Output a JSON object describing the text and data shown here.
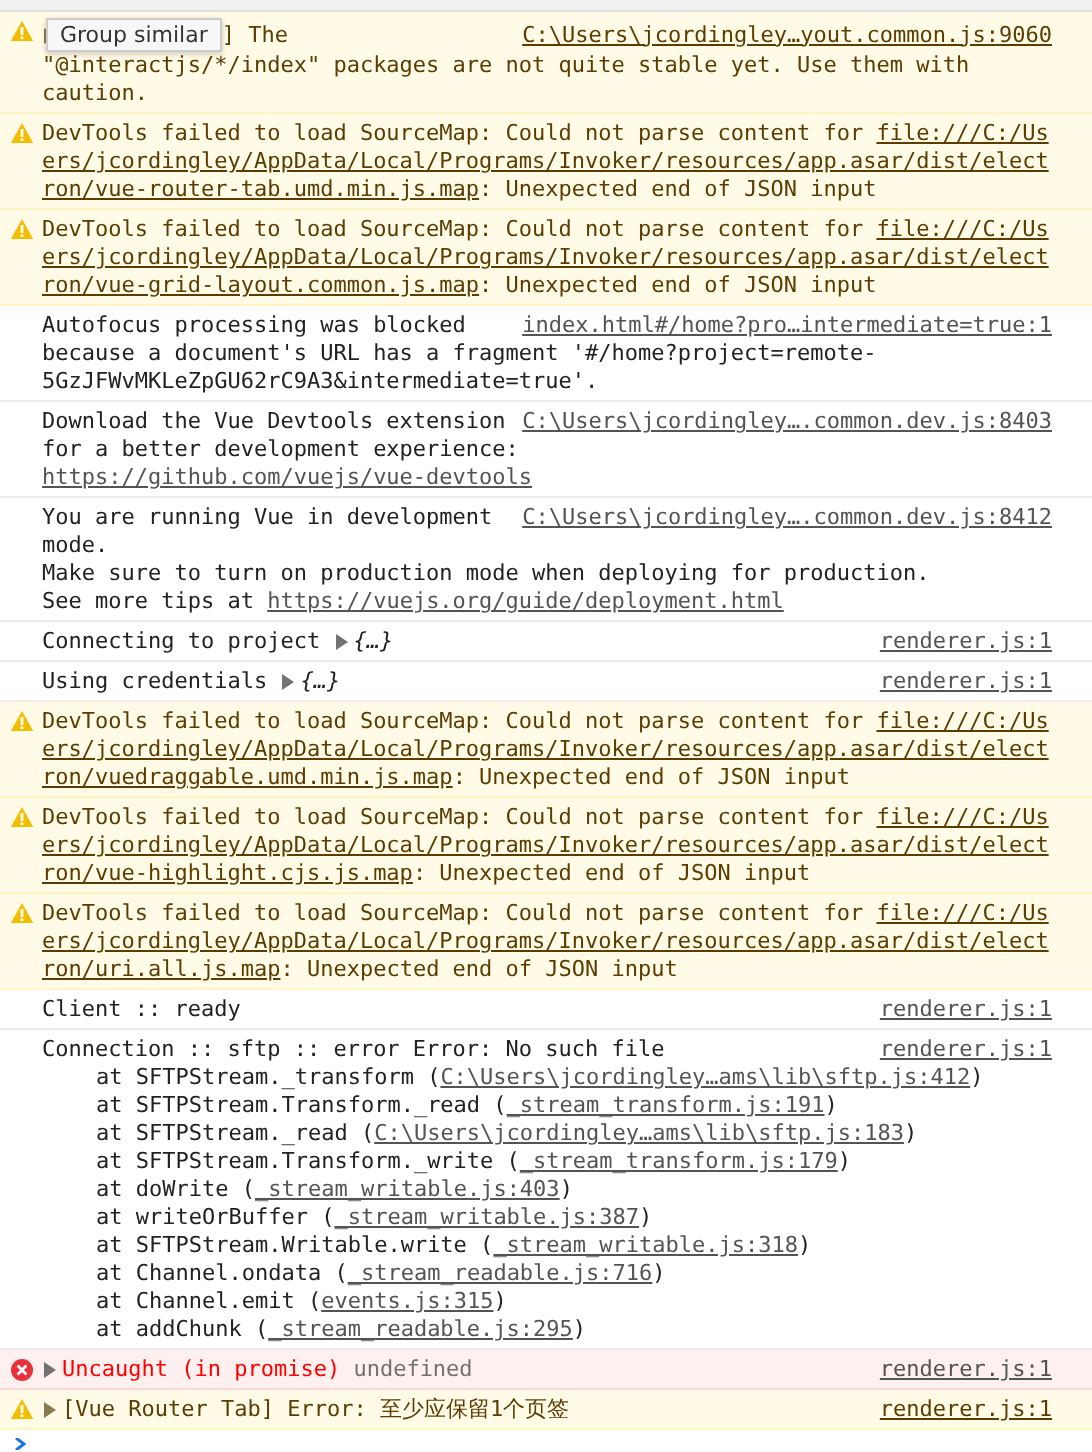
{
  "messages": [
    {
      "kind": "warning",
      "source": "C:\\Users\\jcordingley…yout.common.js:9060",
      "lines": [
        {
          "segments": [
            {
              "kind": "toggle"
            },
            {
              "kind": "tooltip",
              "text": "Group similar"
            },
            {
              "kind": "text",
              "text": "] The"
            }
          ]
        },
        {
          "segments": [
            {
              "kind": "text",
              "text": "\"@interactjs/*/index\" packages are not quite stable yet. Use them with"
            }
          ]
        },
        {
          "segments": [
            {
              "kind": "text",
              "text": "caution."
            }
          ]
        }
      ]
    },
    {
      "kind": "warning",
      "lines": [
        {
          "segments": [
            {
              "kind": "text",
              "text": "DevTools failed to load SourceMap: Could not parse content for "
            },
            {
              "kind": "link",
              "text": "file:///C:/Us"
            }
          ]
        },
        {
          "segments": [
            {
              "kind": "link",
              "text": "ers/jcordingley/AppData/Local/Programs/Invoker/resources/app.asar/dist/elect"
            }
          ]
        },
        {
          "segments": [
            {
              "kind": "link",
              "text": "ron/vue-router-tab.umd.min.js.map"
            },
            {
              "kind": "text",
              "text": ": Unexpected end of JSON input"
            }
          ]
        }
      ]
    },
    {
      "kind": "warning",
      "lines": [
        {
          "segments": [
            {
              "kind": "text",
              "text": "DevTools failed to load SourceMap: Could not parse content for "
            },
            {
              "kind": "link",
              "text": "file:///C:/Us"
            }
          ]
        },
        {
          "segments": [
            {
              "kind": "link",
              "text": "ers/jcordingley/AppData/Local/Programs/Invoker/resources/app.asar/dist/elect"
            }
          ]
        },
        {
          "segments": [
            {
              "kind": "link",
              "text": "ron/vue-grid-layout.common.js.map"
            },
            {
              "kind": "text",
              "text": ": Unexpected end of JSON input"
            }
          ]
        }
      ]
    },
    {
      "kind": "info",
      "source": "index.html#/home?pro…intermediate=true:1",
      "lines": [
        {
          "segments": [
            {
              "kind": "text",
              "text": "Autofocus processing was blocked"
            }
          ]
        },
        {
          "segments": [
            {
              "kind": "text",
              "text": "because a document's URL has a fragment '#/home?project=remote-"
            }
          ]
        },
        {
          "segments": [
            {
              "kind": "text",
              "text": "5GzJFWvMKLeZpGU62rC9A3&intermediate=true'."
            }
          ]
        }
      ]
    },
    {
      "kind": "info",
      "source": "C:\\Users\\jcordingley….common.dev.js:8403",
      "lines": [
        {
          "segments": [
            {
              "kind": "text",
              "text": "Download the Vue Devtools extension"
            }
          ]
        },
        {
          "segments": [
            {
              "kind": "text",
              "text": "for a better development experience:"
            }
          ]
        },
        {
          "segments": [
            {
              "kind": "link",
              "text": "https://github.com/vuejs/vue-devtools"
            }
          ]
        }
      ]
    },
    {
      "kind": "info",
      "source": "C:\\Users\\jcordingley….common.dev.js:8412",
      "lines": [
        {
          "segments": [
            {
              "kind": "text",
              "text": "You are running Vue in development"
            }
          ]
        },
        {
          "segments": [
            {
              "kind": "text",
              "text": "mode."
            }
          ]
        },
        {
          "segments": [
            {
              "kind": "text",
              "text": "Make sure to turn on production mode when deploying for production."
            }
          ]
        },
        {
          "segments": [
            {
              "kind": "text",
              "text": "See more tips at "
            },
            {
              "kind": "link",
              "text": "https://vuejs.org/guide/deployment.html"
            }
          ]
        }
      ]
    },
    {
      "kind": "info",
      "source": "renderer.js:1",
      "lines": [
        {
          "segments": [
            {
              "kind": "text",
              "text": "Connecting to project "
            },
            {
              "kind": "toggle"
            },
            {
              "kind": "object",
              "text": "{…}"
            }
          ]
        }
      ]
    },
    {
      "kind": "info",
      "source": "renderer.js:1",
      "lines": [
        {
          "segments": [
            {
              "kind": "text",
              "text": "Using credentials "
            },
            {
              "kind": "toggle"
            },
            {
              "kind": "object",
              "text": "{…}"
            }
          ]
        }
      ]
    },
    {
      "kind": "warning",
      "lines": [
        {
          "segments": [
            {
              "kind": "text",
              "text": "DevTools failed to load SourceMap: Could not parse content for "
            },
            {
              "kind": "link",
              "text": "file:///C:/Us"
            }
          ]
        },
        {
          "segments": [
            {
              "kind": "link",
              "text": "ers/jcordingley/AppData/Local/Programs/Invoker/resources/app.asar/dist/elect"
            }
          ]
        },
        {
          "segments": [
            {
              "kind": "link",
              "text": "ron/vuedraggable.umd.min.js.map"
            },
            {
              "kind": "text",
              "text": ": Unexpected end of JSON input"
            }
          ]
        }
      ]
    },
    {
      "kind": "warning",
      "lines": [
        {
          "segments": [
            {
              "kind": "text",
              "text": "DevTools failed to load SourceMap: Could not parse content for "
            },
            {
              "kind": "link",
              "text": "file:///C:/Us"
            }
          ]
        },
        {
          "segments": [
            {
              "kind": "link",
              "text": "ers/jcordingley/AppData/Local/Programs/Invoker/resources/app.asar/dist/elect"
            }
          ]
        },
        {
          "segments": [
            {
              "kind": "link",
              "text": "ron/vue-highlight.cjs.js.map"
            },
            {
              "kind": "text",
              "text": ": Unexpected end of JSON input"
            }
          ]
        }
      ]
    },
    {
      "kind": "warning",
      "lines": [
        {
          "segments": [
            {
              "kind": "text",
              "text": "DevTools failed to load SourceMap: Could not parse content for "
            },
            {
              "kind": "link",
              "text": "file:///C:/Us"
            }
          ]
        },
        {
          "segments": [
            {
              "kind": "link",
              "text": "ers/jcordingley/AppData/Local/Programs/Invoker/resources/app.asar/dist/elect"
            }
          ]
        },
        {
          "segments": [
            {
              "kind": "link",
              "text": "ron/uri.all.js.map"
            },
            {
              "kind": "text",
              "text": ": Unexpected end of JSON input"
            }
          ]
        }
      ]
    },
    {
      "kind": "info",
      "source": "renderer.js:1",
      "lines": [
        {
          "segments": [
            {
              "kind": "text",
              "text": "Client :: ready"
            }
          ]
        }
      ]
    },
    {
      "kind": "info",
      "source": "renderer.js:1",
      "lines": [
        {
          "segments": [
            {
              "kind": "text",
              "text": "Connection :: sftp :: error Error: No such file"
            }
          ]
        },
        {
          "indent": true,
          "segments": [
            {
              "kind": "text",
              "text": "at SFTPStream._transform ("
            },
            {
              "kind": "link",
              "text": "C:\\Users\\jcordingley…ams\\lib\\sftp.js:412"
            },
            {
              "kind": "text",
              "text": ")"
            }
          ]
        },
        {
          "indent": true,
          "segments": [
            {
              "kind": "text",
              "text": "at SFTPStream.Transform._read ("
            },
            {
              "kind": "link",
              "text": "_stream_transform.js:191"
            },
            {
              "kind": "text",
              "text": ")"
            }
          ]
        },
        {
          "indent": true,
          "segments": [
            {
              "kind": "text",
              "text": "at SFTPStream._read ("
            },
            {
              "kind": "link",
              "text": "C:\\Users\\jcordingley…ams\\lib\\sftp.js:183"
            },
            {
              "kind": "text",
              "text": ")"
            }
          ]
        },
        {
          "indent": true,
          "segments": [
            {
              "kind": "text",
              "text": "at SFTPStream.Transform._write ("
            },
            {
              "kind": "link",
              "text": "_stream_transform.js:179"
            },
            {
              "kind": "text",
              "text": ")"
            }
          ]
        },
        {
          "indent": true,
          "segments": [
            {
              "kind": "text",
              "text": "at doWrite ("
            },
            {
              "kind": "link",
              "text": "_stream_writable.js:403"
            },
            {
              "kind": "text",
              "text": ")"
            }
          ]
        },
        {
          "indent": true,
          "segments": [
            {
              "kind": "text",
              "text": "at writeOrBuffer ("
            },
            {
              "kind": "link",
              "text": "_stream_writable.js:387"
            },
            {
              "kind": "text",
              "text": ")"
            }
          ]
        },
        {
          "indent": true,
          "segments": [
            {
              "kind": "text",
              "text": "at SFTPStream.Writable.write ("
            },
            {
              "kind": "link",
              "text": "_stream_writable.js:318"
            },
            {
              "kind": "text",
              "text": ")"
            }
          ]
        },
        {
          "indent": true,
          "segments": [
            {
              "kind": "text",
              "text": "at Channel.ondata ("
            },
            {
              "kind": "link",
              "text": "_stream_readable.js:716"
            },
            {
              "kind": "text",
              "text": ")"
            }
          ]
        },
        {
          "indent": true,
          "segments": [
            {
              "kind": "text",
              "text": "at Channel.emit ("
            },
            {
              "kind": "link",
              "text": "events.js:315"
            },
            {
              "kind": "text",
              "text": ")"
            }
          ]
        },
        {
          "indent": true,
          "segments": [
            {
              "kind": "text",
              "text": "at addChunk ("
            },
            {
              "kind": "link",
              "text": "_stream_readable.js:295"
            },
            {
              "kind": "text",
              "text": ")"
            }
          ]
        }
      ]
    },
    {
      "kind": "error",
      "source": "renderer.js:1",
      "lines": [
        {
          "segments": [
            {
              "kind": "toggle"
            },
            {
              "kind": "exception",
              "text": "Uncaught (in promise)"
            },
            {
              "kind": "text",
              "text": " undefined"
            }
          ]
        }
      ]
    },
    {
      "kind": "warning",
      "source": "renderer.js:1",
      "lines": [
        {
          "segments": [
            {
              "kind": "toggle"
            },
            {
              "kind": "text",
              "text": "[Vue Router Tab] Error: 至少应保留1个页签"
            }
          ]
        }
      ]
    }
  ]
}
